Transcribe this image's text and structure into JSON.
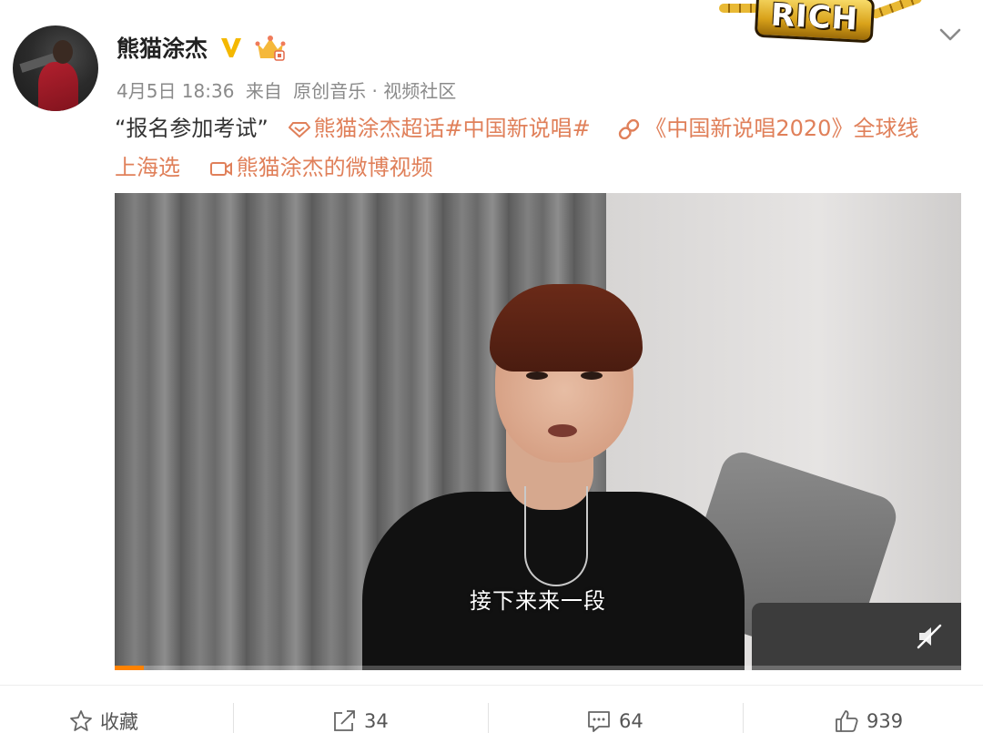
{
  "user": {
    "name": "熊猫涂杰",
    "rich_badge": "RICH"
  },
  "meta": {
    "date": "4月5日 18:36",
    "from": "来自",
    "source": "原创音乐 · 视频社区"
  },
  "post": {
    "quote": "“报名参加考试”",
    "supertopic": "熊猫涂杰超话",
    "hashtag": "#中国新说唱#",
    "link_line1": "《中国新说唱2020》全球线",
    "link_line2": "上海选",
    "video_link": "熊猫涂杰的微博视频"
  },
  "video": {
    "subtitle": "接下来来一段",
    "progress": 0.034
  },
  "actions": {
    "favorite_label": "收藏",
    "repost_count": "34",
    "comment_count": "64",
    "like_count": "939"
  },
  "colors": {
    "link": "#e0805a",
    "progress": "#ff8200",
    "verified": "#f4b800"
  }
}
